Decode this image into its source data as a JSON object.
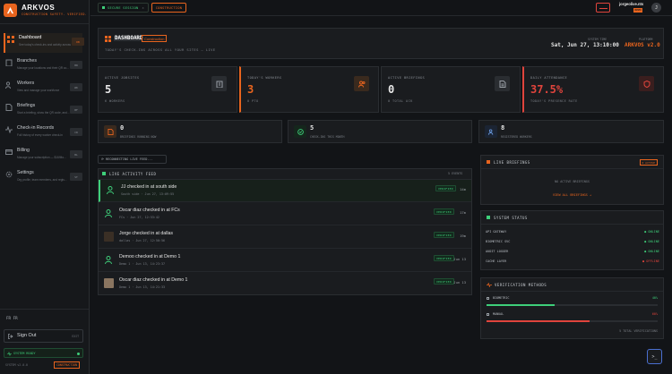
{
  "app": {
    "name": "ARKVOS",
    "tagline": "CONSTRUCTION SAFETY. VERIFIED."
  },
  "sidebar": {
    "items": [
      {
        "label": "Dashboard",
        "desc": "See today's check-ins and activity across",
        "key": "DB"
      },
      {
        "label": "Branches",
        "desc": "Manage your locations and their QR co...",
        "key": "BR"
      },
      {
        "label": "Workers",
        "desc": "View and manage your workforce",
        "key": "WK"
      },
      {
        "label": "Briefings",
        "desc": "Start a briefing, show the QR code, and...",
        "key": "BF"
      },
      {
        "label": "Check-in Records",
        "desc": "Full history of every worker check-in",
        "key": "CR"
      },
      {
        "label": "Billing",
        "desc": "Manage your subscription — $10/Mo...",
        "key": "BL"
      },
      {
        "label": "Settings",
        "desc": "Org profile, team members, and regis...",
        "key": "ST"
      }
    ],
    "language": "FR FR",
    "sign_out": "Sign Out",
    "sign_out_key": "EXIT",
    "system_ready": "SYSTEM READY",
    "version": "SYSTEM v2.0.0",
    "mode": "CONSTRUCTION"
  },
  "topbar": {
    "session": "SECURE SESSION",
    "mode": "CONSTRUCTION",
    "username": "jorgeolive.nts",
    "role": "OWNER",
    "avatar": "J"
  },
  "header": {
    "title": "DASHBOARD",
    "badge": "Construction",
    "subtitle": "TODAY'S CHECK-INS ACROSS ALL YOUR SITES — LIVE",
    "system_time_label": "SYSTEM TIME",
    "system_time": "Sat, Jun 27, 13:10:00",
    "platform_label": "PLATFORM",
    "platform": "ARKVOS v2.0"
  },
  "stats": [
    {
      "label": "ACTIVE JOBSITES",
      "value": "5",
      "sub": "6 WORKERS"
    },
    {
      "label": "TODAY'S WORKERS",
      "value": "3",
      "sub": "0 PTO"
    },
    {
      "label": "ACTIVE BRIEFINGS",
      "value": "0",
      "sub": "0 TOTAL ACK"
    },
    {
      "label": "DAILY ATTENDANCE",
      "value": "37.5%",
      "sub": "TODAY'S PRESENCE RATE"
    }
  ],
  "mini_stats": [
    {
      "value": "0",
      "label": "BRIEFINGS RUNNING NOW"
    },
    {
      "value": "5",
      "label": "CHECK-INS THIS MONTH"
    },
    {
      "value": "8",
      "label": "REGISTERED WORKERS"
    }
  ],
  "reconnecting": "RECONNECTING LIVE FEED...",
  "feed": {
    "title": "LIVE ACTIVITY FEED",
    "count": "5 EVENTS",
    "items": [
      {
        "name": "JJ checked in at south side",
        "meta": "South side · Jun 27, 13:09:55",
        "badge": "VERIFIED",
        "time": "14m"
      },
      {
        "name": "Oscar diaz checked in at FCs",
        "meta": "FCs · Jun 27, 12:53:42",
        "badge": "VERIFIED",
        "time": "17m"
      },
      {
        "name": "Jorge checked in at dallas",
        "meta": "dallas · Jun 27, 12:50:56",
        "badge": "VERIFIED",
        "time": "19m"
      },
      {
        "name": "Demoo checked in at Demo 1",
        "meta": "Demo 1 · Jun 13, 14:23:37",
        "badge": "VERIFIED",
        "time": "Jun 13"
      },
      {
        "name": "Oscar diaz checked in at Demo 1",
        "meta": "Demo 1 · Jun 13, 14:21:33",
        "badge": "VERIFIED",
        "time": "Jun 13"
      }
    ]
  },
  "briefings": {
    "title": "LIVE BRIEFINGS",
    "status": "0 ACTIVE",
    "empty": "NO ACTIVE BRIEFINGS",
    "link": "VIEW ALL BRIEFINGS →"
  },
  "system_status": {
    "title": "SYSTEM STATUS",
    "rows": [
      {
        "name": "API GATEWAY",
        "status": "ONLINE"
      },
      {
        "name": "BIOMETRIC SVC",
        "status": "ONLINE"
      },
      {
        "name": "AUDIT LOGGER",
        "status": "ONLINE"
      },
      {
        "name": "CACHE LAYER",
        "status": "OFFLINE"
      }
    ]
  },
  "verification": {
    "title": "VERIFICATION METHODS",
    "methods": [
      {
        "name": "BIOMETRIC",
        "percent": "40%",
        "fraction": 0.4
      },
      {
        "name": "MANUAL",
        "percent": "60%",
        "fraction": 0.6
      }
    ],
    "total": "5 TOTAL VERIFICATIONS"
  },
  "colors": {
    "accent": "#e8641e",
    "green": "#3ecf7a",
    "red": "#e0443c",
    "bg": "#121417"
  }
}
